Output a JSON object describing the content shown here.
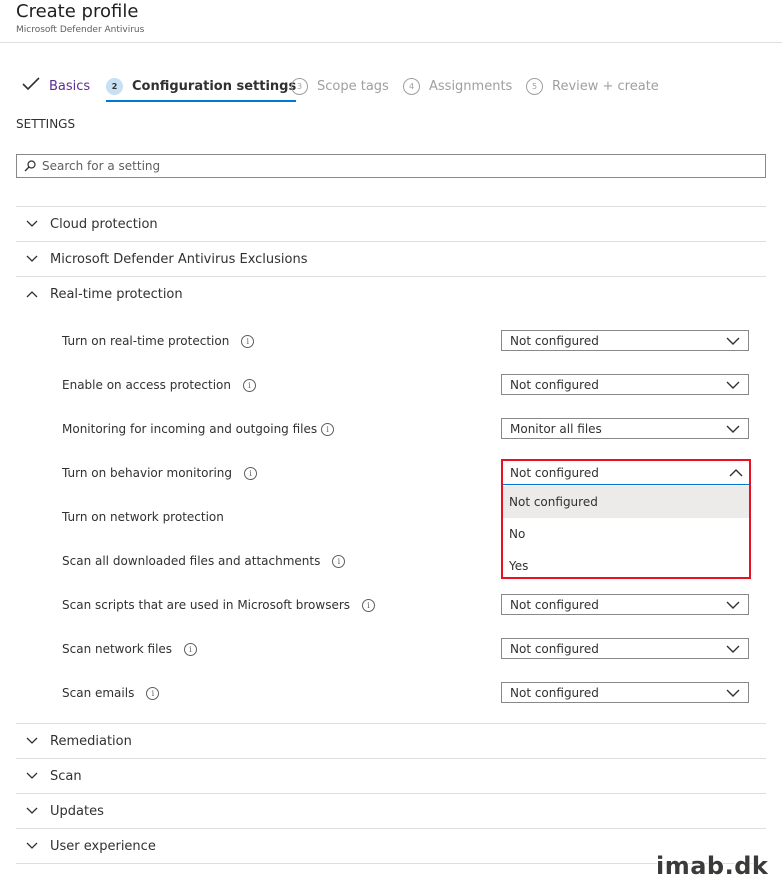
{
  "header": {
    "title": "Create profile",
    "subtitle": "Microsoft Defender Antivirus"
  },
  "wizard": {
    "steps": [
      {
        "label": "Basics",
        "num": ""
      },
      {
        "label": "Configuration settings",
        "num": "2"
      },
      {
        "label": "Scope tags",
        "num": "3"
      },
      {
        "label": "Assignments",
        "num": "4"
      },
      {
        "label": "Review + create",
        "num": "5"
      }
    ]
  },
  "settings_label": "SETTINGS",
  "search": {
    "placeholder": "Search for a setting"
  },
  "sections": {
    "cloud": "Cloud protection",
    "exclusions": "Microsoft Defender Antivirus Exclusions",
    "realtime": "Real-time protection",
    "remediation": "Remediation",
    "scan": "Scan",
    "updates": "Updates",
    "ux": "User experience"
  },
  "rows": [
    {
      "label": "Turn on real-time protection",
      "value": "Not configured"
    },
    {
      "label": "Enable on access protection",
      "value": "Not configured"
    },
    {
      "label": "Monitoring for incoming and outgoing files",
      "value": "Monitor all files"
    },
    {
      "label": "Turn on behavior monitoring",
      "value": "Not configured"
    },
    {
      "label": "Turn on network protection",
      "value": ""
    },
    {
      "label": "Scan all downloaded files and attachments",
      "value": ""
    },
    {
      "label": "Scan scripts that are used in Microsoft browsers",
      "value": "Not configured"
    },
    {
      "label": "Scan network files",
      "value": "Not configured"
    },
    {
      "label": "Scan emails",
      "value": "Not configured"
    }
  ],
  "dropdown_options": [
    "Not configured",
    "No",
    "Yes"
  ],
  "watermark": "imab.dk",
  "colors": {
    "accent": "#0078d4",
    "highlight": "#e81123",
    "done": "#5c2e91"
  }
}
